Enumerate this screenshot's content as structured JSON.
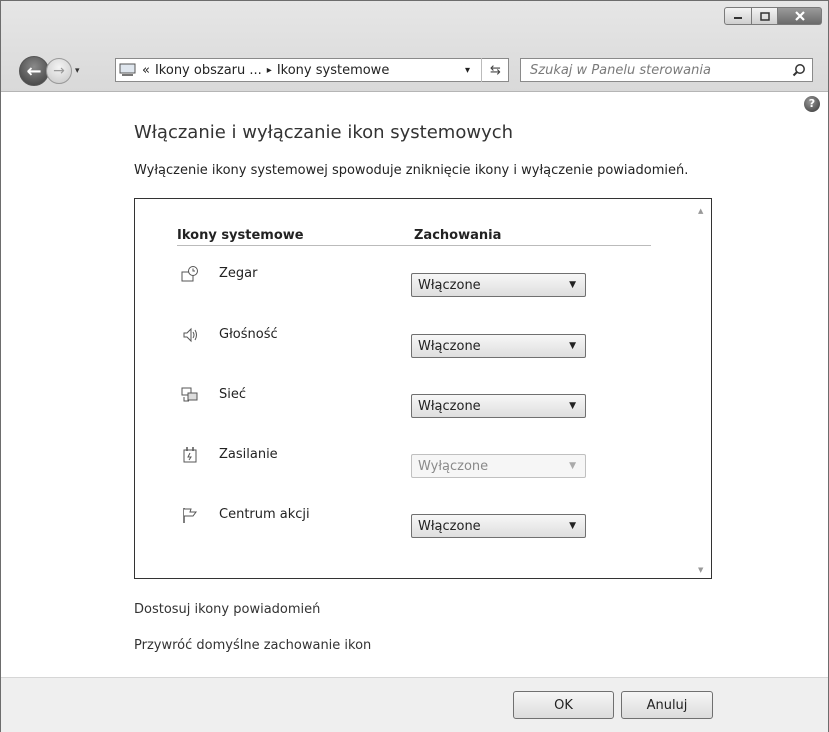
{
  "window": {
    "controls": {
      "minimize": "minimize-icon",
      "maximize": "maximize-icon",
      "close": "close-icon"
    }
  },
  "nav": {
    "back_glyph": "←",
    "forward_glyph": "→",
    "dropdown_glyph": "▾"
  },
  "address": {
    "prefix": "«",
    "crumbs": [
      "Ikony obszaru ...",
      "Ikony systemowe"
    ],
    "separator": "▸",
    "dropdown_glyph": "▾",
    "refresh_glyph": "⇆"
  },
  "search": {
    "placeholder": "Szukaj w Panelu sterowania",
    "icon": "search-icon"
  },
  "help": {
    "glyph": "?"
  },
  "page": {
    "title": "Włączanie i wyłączanie ikon systemowych",
    "description": "Wyłączenie ikony systemowej spowoduje zniknięcie ikony i wyłączenie powiadomień."
  },
  "table": {
    "col_icons": "Ikony systemowe",
    "col_behaviors": "Zachowania",
    "scroll_up": "▲",
    "scroll_down": "▼",
    "rows": [
      {
        "icon": "clock-icon",
        "label": "Zegar",
        "value": "Włączone",
        "enabled": true
      },
      {
        "icon": "volume-icon",
        "label": "Głośność",
        "value": "Włączone",
        "enabled": true
      },
      {
        "icon": "network-icon",
        "label": "Sieć",
        "value": "Włączone",
        "enabled": true
      },
      {
        "icon": "power-icon",
        "label": "Zasilanie",
        "value": "Wyłączone",
        "enabled": false
      },
      {
        "icon": "action-center-flag-icon",
        "label": "Centrum akcji",
        "value": "Włączone",
        "enabled": true
      }
    ],
    "dropdown_arrow": "▼"
  },
  "links": {
    "customize": "Dostosuj ikony powiadomień",
    "restore": "Przywróć domyślne zachowanie ikon"
  },
  "footer": {
    "ok": "OK",
    "cancel": "Anuluj"
  }
}
